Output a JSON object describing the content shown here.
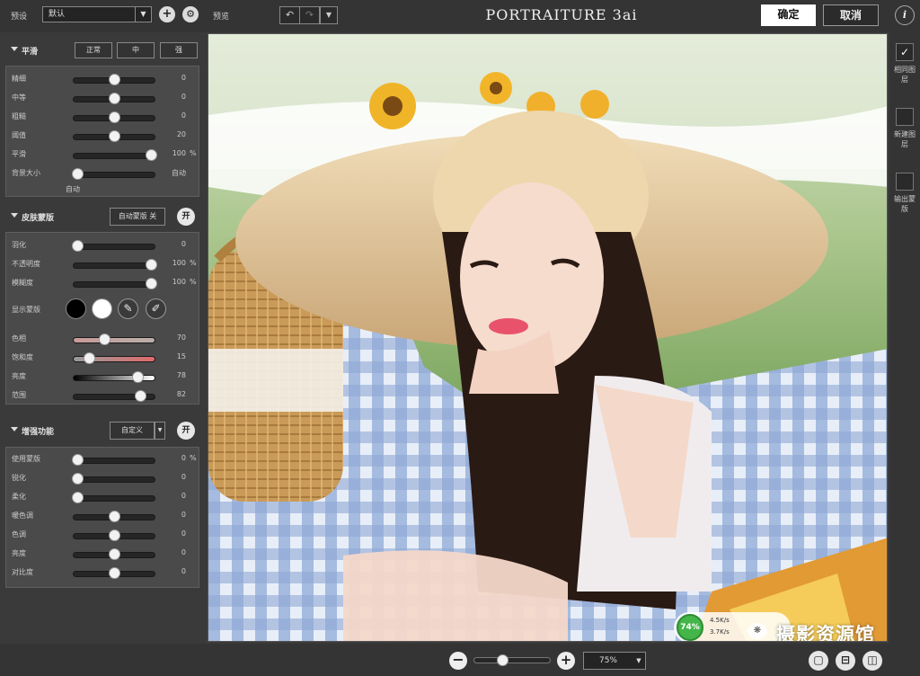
{
  "topbar": {
    "preset_label": "预设",
    "preset_value": "默认",
    "preview_label": "预览",
    "brand": "PORTRAITURE 3ai",
    "ok_label": "确定",
    "cancel_label": "取消"
  },
  "smooth": {
    "title": "平滑",
    "buttons": [
      "正常",
      "中",
      "强"
    ],
    "sliders": [
      {
        "label": "精细",
        "value": "0",
        "pos": 0.5
      },
      {
        "label": "中等",
        "value": "0",
        "pos": 0.5
      },
      {
        "label": "粗糙",
        "value": "0",
        "pos": 0.5
      },
      {
        "label": "阈值",
        "value": "20",
        "pos": 0.5
      },
      {
        "label": "平滑",
        "value": "100",
        "unit": "%",
        "pos": 0.95
      },
      {
        "label": "背景大小",
        "value": "自动",
        "pos": 0.05
      }
    ],
    "auto_label": "自动"
  },
  "skin": {
    "title": "皮肤蒙版",
    "auto_btn": "自动蒙版 关",
    "toggle": "开",
    "sliders": [
      {
        "label": "羽化",
        "value": "0",
        "pos": 0.05
      },
      {
        "label": "不透明度",
        "value": "100",
        "unit": "%",
        "pos": 0.95
      },
      {
        "label": "模糊度",
        "value": "100",
        "unit": "%",
        "pos": 0.95
      }
    ],
    "display_label": "显示蒙版",
    "sliders2": [
      {
        "label": "色相",
        "value": "70",
        "pos": 0.38
      },
      {
        "label": "饱和度",
        "value": "15",
        "pos": 0.2
      },
      {
        "label": "亮度",
        "value": "78",
        "pos": 0.78
      },
      {
        "label": "范围",
        "value": "82",
        "pos": 0.82
      }
    ]
  },
  "enhance": {
    "title": "增强功能",
    "select_value": "自定义",
    "toggle": "开",
    "sliders": [
      {
        "label": "使用蒙版",
        "value": "0",
        "unit": "%",
        "pos": 0.05
      },
      {
        "label": "锐化",
        "value": "0",
        "pos": 0.05
      },
      {
        "label": "柔化",
        "value": "0",
        "pos": 0.05
      },
      {
        "label": "暖色调",
        "value": "0",
        "pos": 0.5
      },
      {
        "label": "色调",
        "value": "0",
        "pos": 0.5
      },
      {
        "label": "亮度",
        "value": "0",
        "pos": 0.5
      },
      {
        "label": "对比度",
        "value": "0",
        "pos": 0.5
      }
    ]
  },
  "rightbar": {
    "items": [
      "相同图层",
      "新建图层",
      "输出蒙版"
    ]
  },
  "overlay": {
    "percent": "74%",
    "up": "4.5K/s",
    "down": "3.7K/s",
    "watermark": "摄影资源馆"
  },
  "bottombar": {
    "zoom_value": "75%",
    "zoom_pos": 0.37
  },
  "colors": {
    "ok_bg": "#ffffff",
    "panel_bg": "#4a4a4a",
    "bg": "#3a3a3a"
  }
}
